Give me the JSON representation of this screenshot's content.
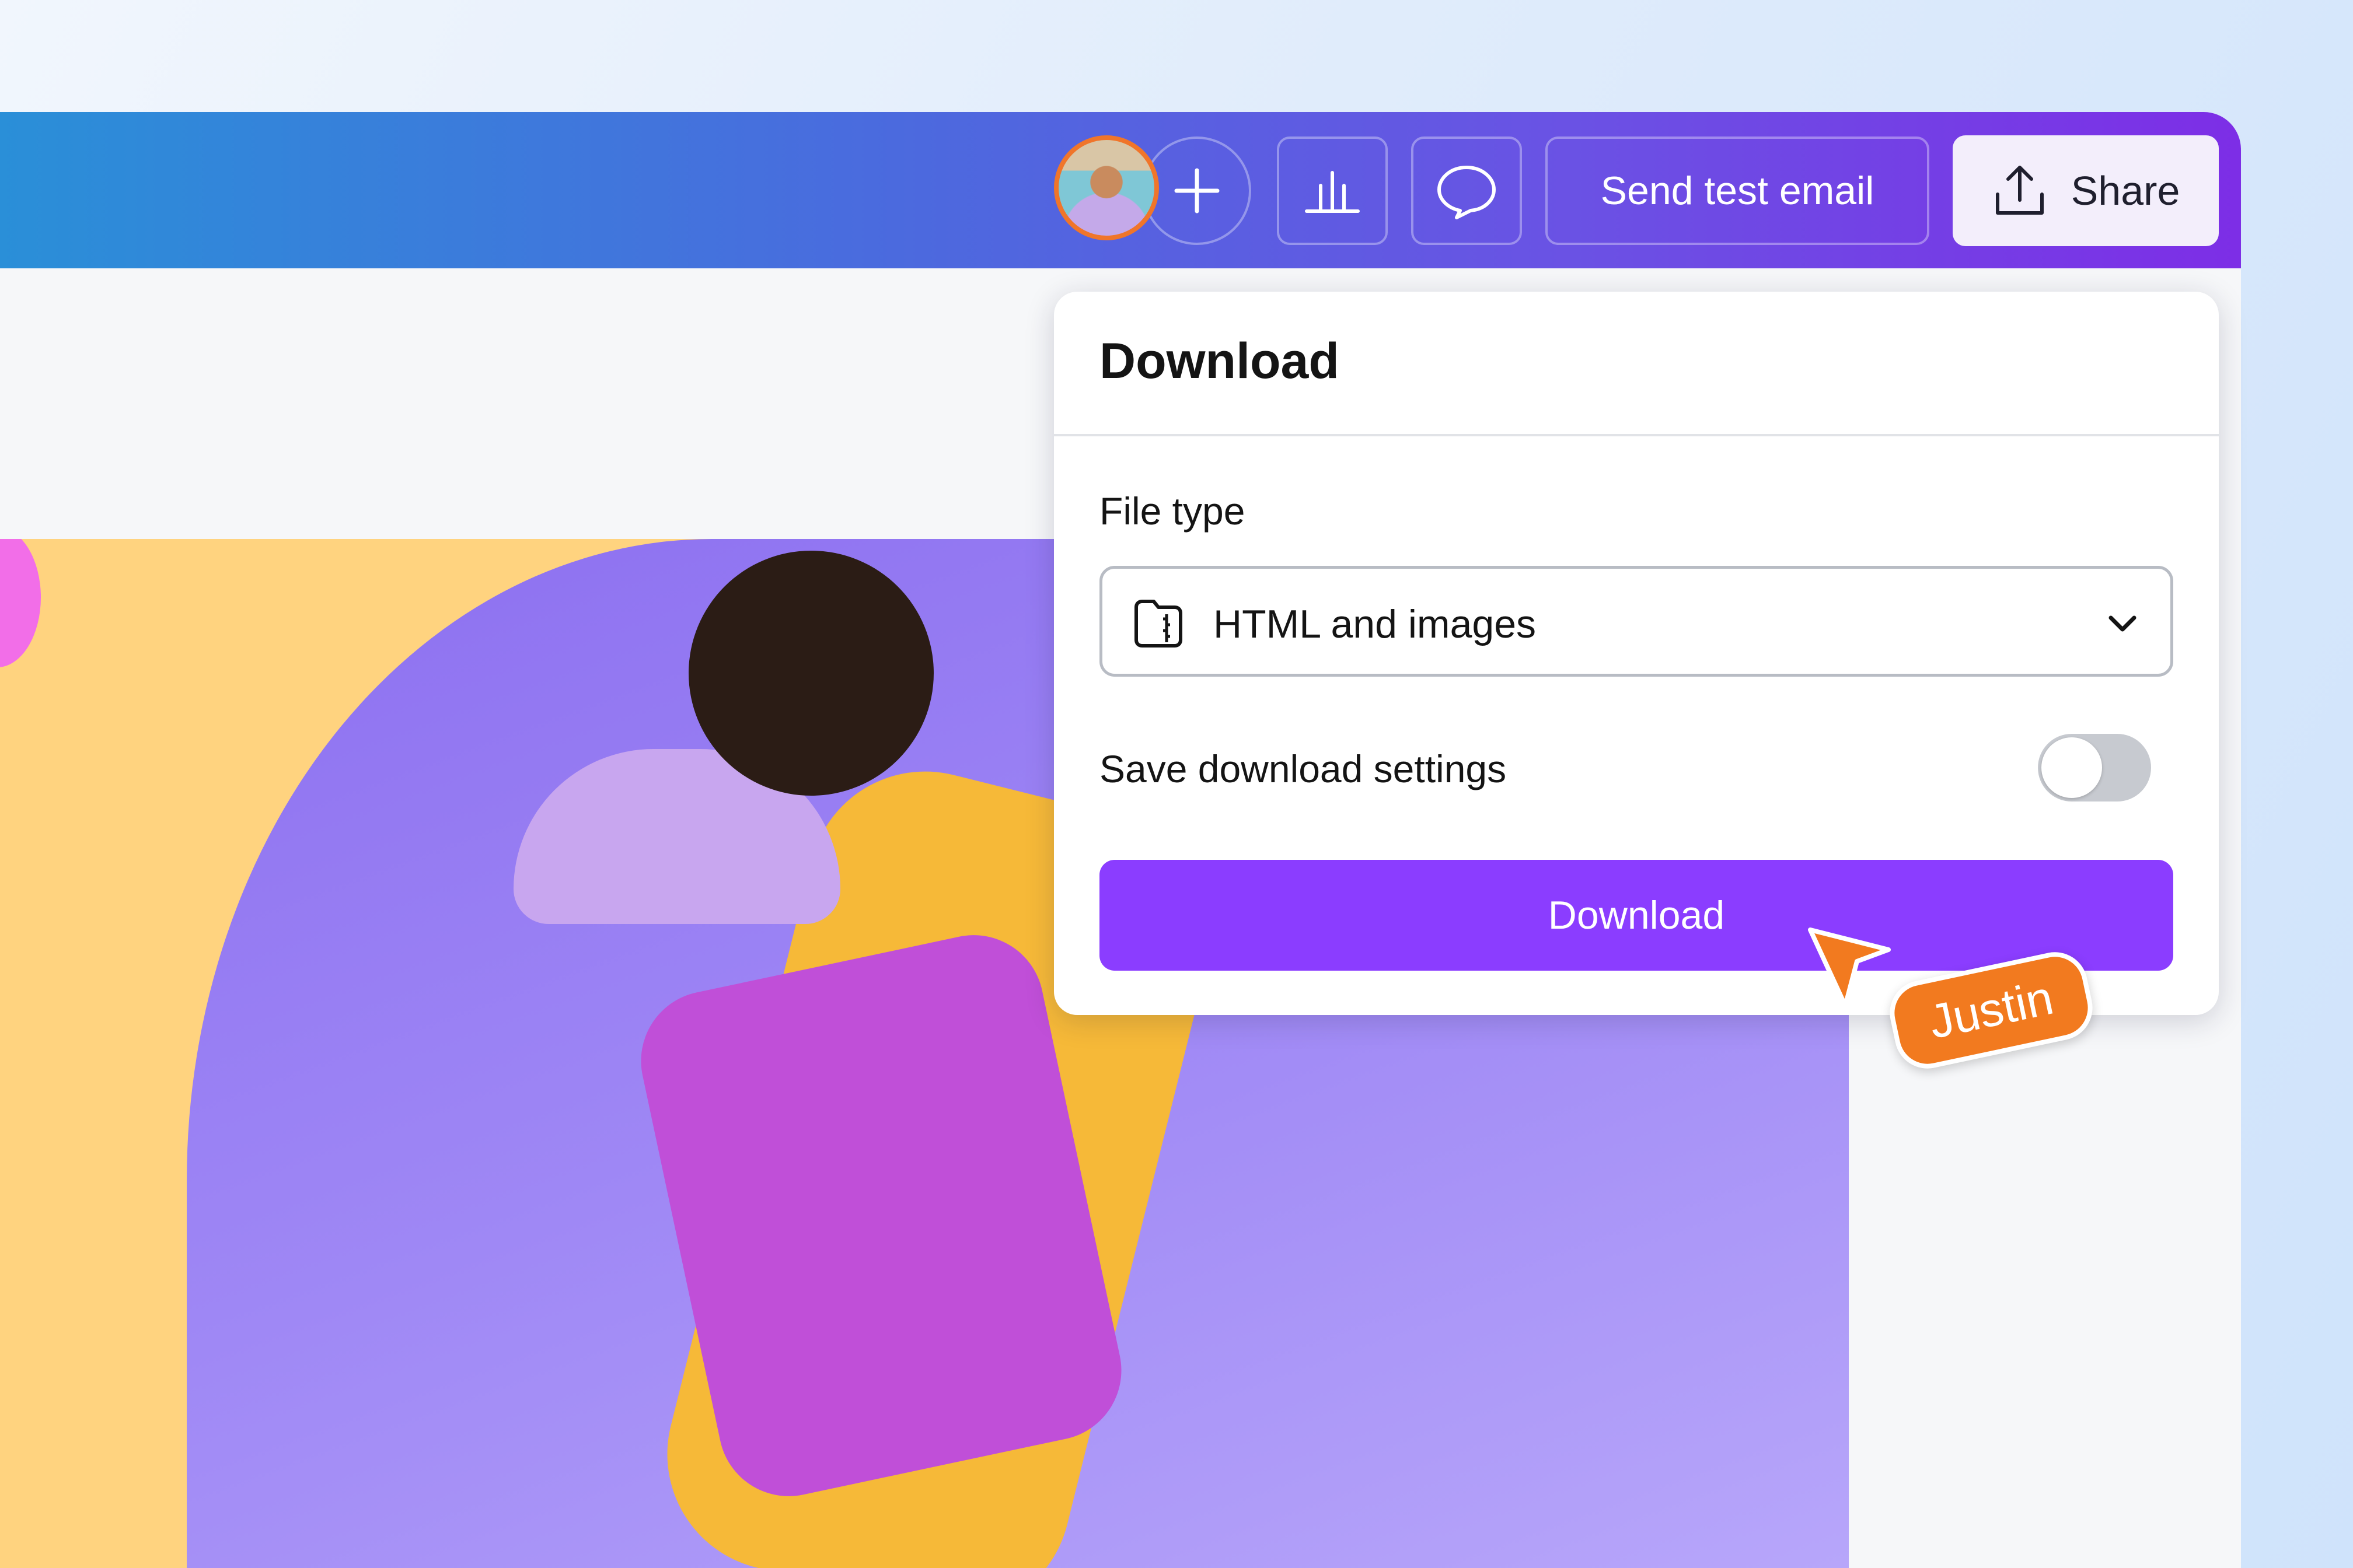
{
  "toolbar": {
    "avatar_icon": "user-avatar",
    "add_icon": "plus-icon",
    "insights_icon": "bar-chart-icon",
    "comment_icon": "speech-bubble-icon",
    "send_test_email_label": "Send test email",
    "share_label": "Share",
    "share_icon": "upload-icon"
  },
  "download_panel": {
    "title": "Download",
    "file_type_label": "File type",
    "file_type_value": "HTML and images",
    "file_type_icon": "zip-folder-icon",
    "save_settings_label": "Save download settings",
    "save_settings_enabled": false,
    "download_button_label": "Download"
  },
  "collaborator_cursor": {
    "name": "Justin",
    "color": "#f27a1f"
  },
  "colors": {
    "accent": "#8b3dff",
    "topbar_start": "#2a8fd8",
    "topbar_end": "#7d2ee6"
  }
}
